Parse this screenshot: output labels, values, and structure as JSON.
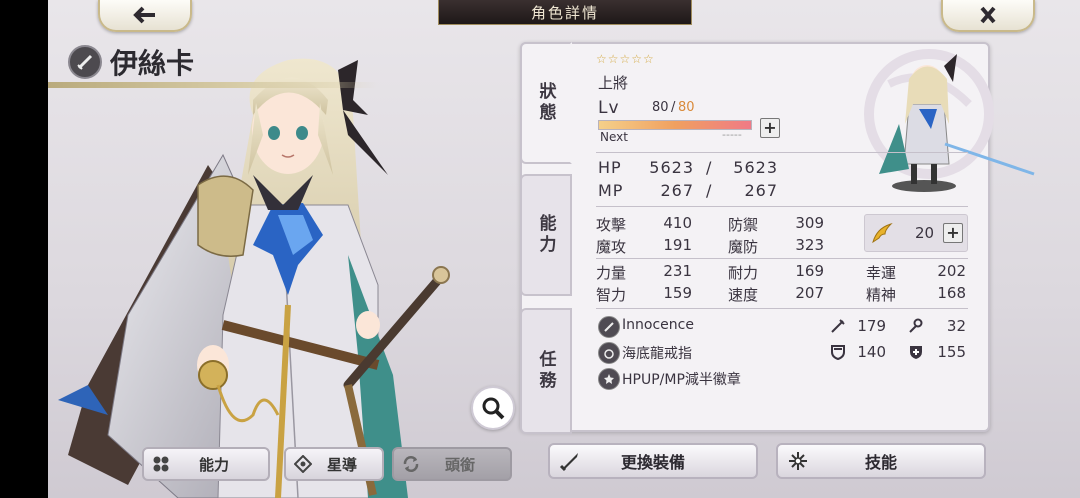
{
  "header": {
    "title": "角色詳情"
  },
  "character": {
    "name": "伊絲卡"
  },
  "panel": {
    "tabs": [
      "狀態",
      "能力",
      "任務"
    ],
    "stars": "☆☆☆☆☆",
    "rank": "上將",
    "lv_label": "Lv",
    "lv_current": "80",
    "lv_sep": "/",
    "lv_max": "80",
    "next_label": "Next",
    "next_value": "-----",
    "hp_label": "HP",
    "hp_current": "5623",
    "hp_sep": "/",
    "hp_max": "5623",
    "mp_label": "MP",
    "mp_current": "267",
    "mp_sep": "/",
    "mp_max": "267",
    "stats": {
      "atk_label": "攻擊",
      "atk": "410",
      "def_label": "防禦",
      "def": "309",
      "matk_label": "魔攻",
      "matk": "191",
      "mdef_label": "魔防",
      "mdef": "323",
      "str_label": "力量",
      "str": "231",
      "vit_label": "耐力",
      "vit": "169",
      "luck_label": "幸運",
      "luck": "202",
      "int_label": "智力",
      "int": "159",
      "spd_label": "速度",
      "spd": "207",
      "spr_label": "精神",
      "spr": "168"
    },
    "wing_value": "20",
    "equipment": [
      {
        "name": "Innocence",
        "icon": "sword-icon"
      },
      {
        "name": "海底龍戒指",
        "icon": "ring-icon"
      },
      {
        "name": "HPUP/MP減半徽章",
        "icon": "badge-icon"
      }
    ],
    "equip_stats": {
      "attack": "179",
      "magic": "32",
      "defense": "140",
      "mdefense": "155"
    }
  },
  "buttons": {
    "ability": "能力",
    "star_guide": "星導",
    "title_rank": "頭銜",
    "change_equip": "更換裝備",
    "skills": "技能"
  },
  "colors": {
    "accent_gold": "#c9b98a",
    "exp_bar_start": "#f5d08a",
    "exp_bar_end": "#f07a86",
    "lv_max_color": "#d98a3a"
  }
}
